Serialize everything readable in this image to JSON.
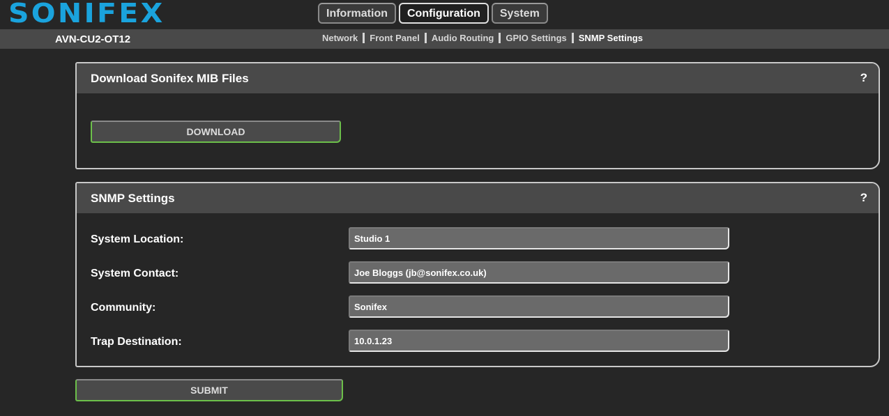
{
  "header": {
    "logo_text": "SONIFEX",
    "brand_color": "#1aa3dd",
    "tabs": [
      {
        "label": "Information",
        "active": false
      },
      {
        "label": "Configuration",
        "active": true
      },
      {
        "label": "System",
        "active": false
      }
    ]
  },
  "subheader": {
    "device_name": "AVN-CU2-OT12",
    "nav": [
      {
        "label": "Network",
        "active": false
      },
      {
        "label": "Front Panel",
        "active": false
      },
      {
        "label": "Audio Routing",
        "active": false
      },
      {
        "label": "GPIO Settings",
        "active": false
      },
      {
        "label": "SNMP Settings",
        "active": true
      }
    ]
  },
  "mib_panel": {
    "title": "Download Sonifex MIB Files",
    "help": "?",
    "download_label": "DOWNLOAD"
  },
  "snmp_panel": {
    "title": "SNMP Settings",
    "help": "?",
    "fields": [
      {
        "label": "System Location:",
        "value": "Studio 1"
      },
      {
        "label": "System Contact:",
        "value": "Joe Bloggs (jb@sonifex.co.uk)"
      },
      {
        "label": "Community:",
        "value": "Sonifex"
      },
      {
        "label": "Trap Destination:",
        "value": "10.0.1.23"
      }
    ]
  },
  "submit_label": "SUBMIT",
  "colors": {
    "accent_green": "#6cc04a",
    "background": "#262626",
    "bar": "#494949"
  }
}
